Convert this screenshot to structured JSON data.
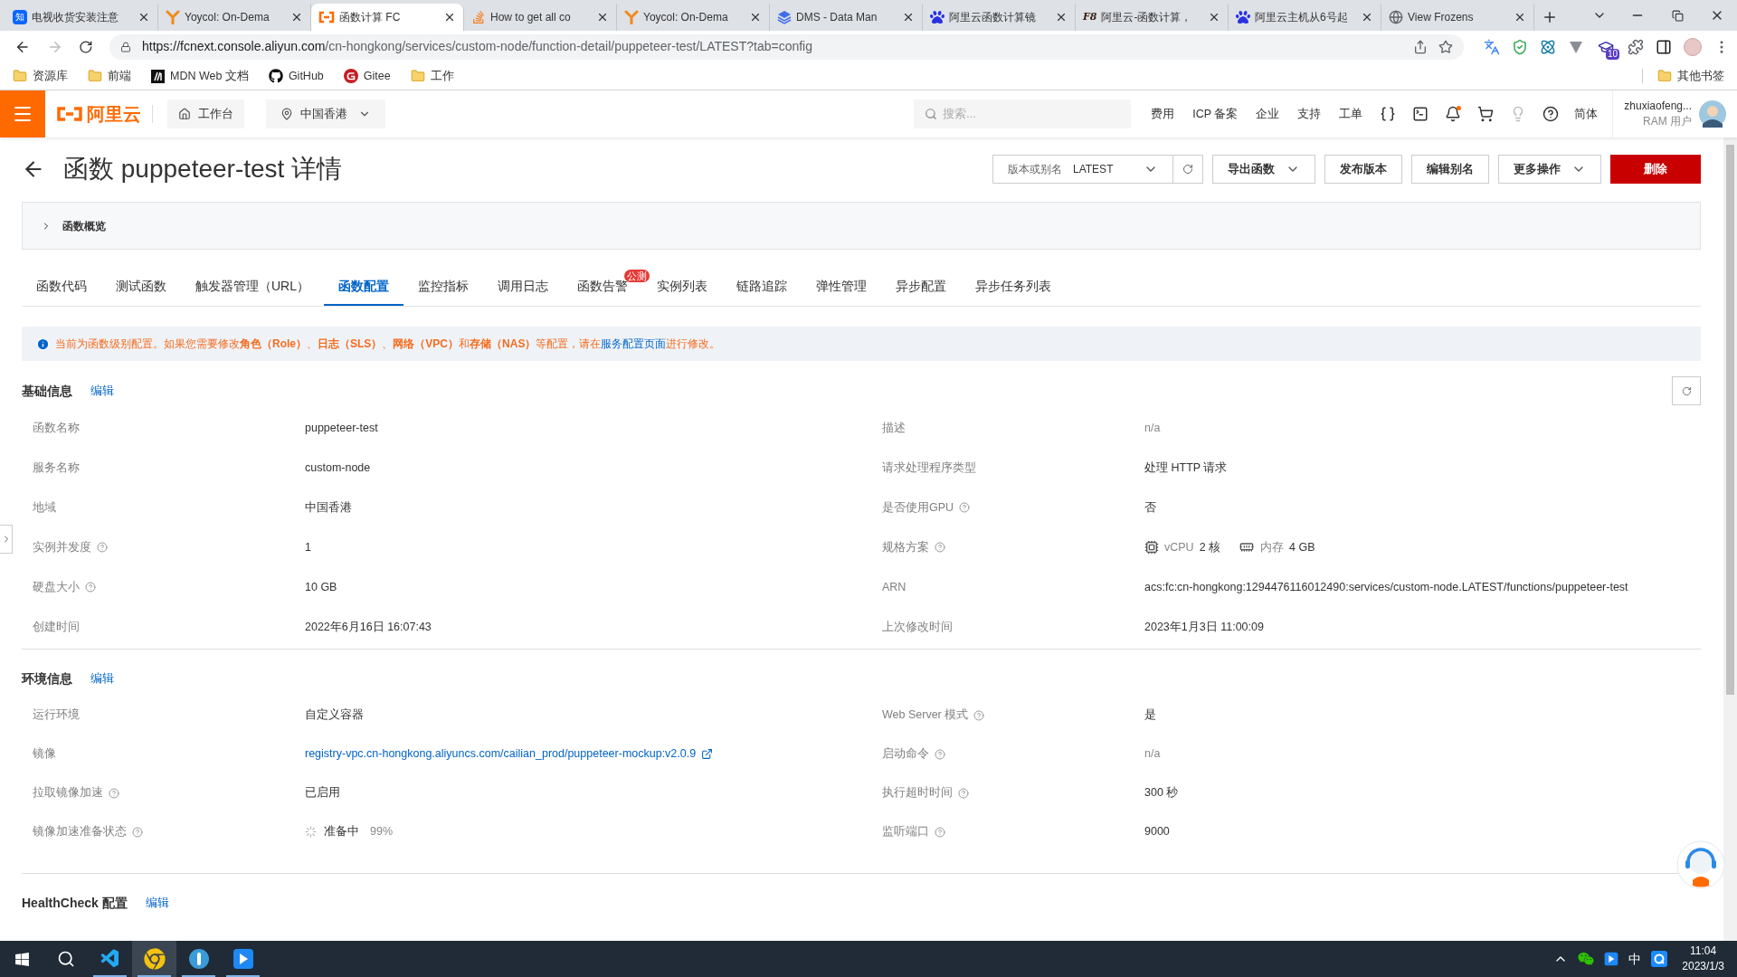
{
  "browser": {
    "tabs": [
      {
        "icon_text": "知",
        "title": "电视收货安装注意",
        "selected": false
      },
      {
        "title": "Yoycol: On-Dema",
        "selected": false
      },
      {
        "title": "函数计算 FC",
        "selected": true
      },
      {
        "title": "How to get all co",
        "selected": false
      },
      {
        "title": "Yoycol: On-Dema",
        "selected": false
      },
      {
        "title": "DMS - Data Man",
        "selected": false
      },
      {
        "title": "阿里云函数计算镜",
        "selected": false
      },
      {
        "icon_text": "F8",
        "title": "阿里云-函数计算，",
        "selected": false
      },
      {
        "title": "阿里云主机从6号起",
        "selected": false
      },
      {
        "title": "View Frozens",
        "selected": false
      }
    ],
    "url_host": "https://fcnext.console.aliyun.com",
    "url_path": "/cn-hongkong/services/custom-node/function-detail/puppeteer-test/LATEST?tab=config",
    "extension_badge": "10",
    "bookmarks": [
      "资源库",
      "前端",
      "MDN Web 文档",
      "GitHub",
      "Gitee",
      "工作"
    ],
    "other_bookmarks": "其他书签"
  },
  "console_header": {
    "logo": "阿里云",
    "workbench": "工作台",
    "region": "中国香港",
    "search": {
      "placeholder": "搜索..."
    },
    "nav": [
      "费用",
      "ICP 备案",
      "企业",
      "支持",
      "工单"
    ],
    "nav_icons": [
      {
        "dot": false
      },
      {
        "dot": false
      },
      {
        "dot": true
      },
      {
        "dot": false
      },
      {
        "dot": false
      },
      {
        "dot": false
      }
    ],
    "language": "简体",
    "user": {
      "name": "zhuxiaofeng...",
      "role": "RAM 用户"
    }
  },
  "page": {
    "title": "函数 puppeteer-test 详情",
    "version_select": {
      "label": "版本或别名",
      "value": "LATEST"
    },
    "buttons": [
      {
        "label": "导出函数",
        "kind": "dropdown"
      },
      {
        "label": "发布版本",
        "kind": "plain"
      },
      {
        "label": "编辑别名",
        "kind": "plain"
      },
      {
        "label": "更多操作",
        "kind": "dropdown"
      },
      {
        "label": "删除",
        "kind": "danger"
      }
    ],
    "overview": {
      "title": "函数概览",
      "expanded": false
    },
    "tabs": [
      {
        "label": "函数代码",
        "selected": false
      },
      {
        "label": "测试函数",
        "selected": false
      },
      {
        "label": "触发器管理（URL）",
        "selected": false
      },
      {
        "label": "函数配置",
        "selected": true
      },
      {
        "label": "监控指标",
        "selected": false
      },
      {
        "label": "调用日志",
        "selected": false
      },
      {
        "label": "函数告警",
        "selected": false,
        "badge": "公测"
      },
      {
        "label": "实例列表",
        "selected": false
      },
      {
        "label": "链路追踪",
        "selected": false
      },
      {
        "label": "弹性管理",
        "selected": false
      },
      {
        "label": "异步配置",
        "selected": false
      },
      {
        "label": "异步任务列表",
        "selected": false
      }
    ],
    "notice": {
      "before": "当前为函数级别配置。如果您需要修改**角色（Role）**、**日志（SLS）**、**网络（VPC）**和**存储（NAS）**等配置，请在",
      "link": "服务配置页面",
      "after": "进行修改。"
    },
    "sections": [
      {
        "title": "基础信息",
        "edit": "编辑",
        "refresh": true,
        "rows": [
          [
            {
              "label": "函数名称",
              "help": false,
              "kind": "text",
              "value": "puppeteer-test"
            },
            {
              "label": "描述",
              "help": false,
              "kind": "muted",
              "value": "n/a"
            }
          ],
          [
            {
              "label": "服务名称",
              "help": false,
              "kind": "text",
              "value": "custom-node"
            },
            {
              "label": "请求处理程序类型",
              "help": false,
              "kind": "text",
              "value": "处理 HTTP 请求"
            }
          ],
          [
            {
              "label": "地域",
              "help": false,
              "kind": "text",
              "value": "中国香港"
            },
            {
              "label": "是否使用GPU",
              "help": true,
              "kind": "text",
              "value": "否"
            }
          ],
          [
            {
              "label": "实例并发度",
              "help": true,
              "kind": "text",
              "value": "1"
            },
            {
              "label": "规格方案",
              "help": true,
              "kind": "spec",
              "items": [
                {
                  "label": "vCPU",
                  "value": "2 核"
                },
                {
                  "label": "内存",
                  "value": "4 GB"
                }
              ]
            }
          ],
          [
            {
              "label": "硬盘大小",
              "help": true,
              "kind": "text",
              "value": "10 GB"
            },
            {
              "label": "ARN",
              "help": false,
              "kind": "text",
              "value": "acs:fc:cn-hongkong:1294476116012490:services/custom-node.LATEST/functions/puppeteer-test"
            }
          ],
          [
            {
              "label": "创建时间",
              "help": false,
              "kind": "text",
              "value": "2022年6月16日 16:07:43"
            },
            {
              "label": "上次修改时间",
              "help": false,
              "kind": "text",
              "value": "2023年1月3日 11:00:09"
            }
          ]
        ]
      },
      {
        "title": "环境信息",
        "edit": "编辑",
        "refresh": false,
        "rows": [
          [
            {
              "label": "运行环境",
              "help": false,
              "kind": "text",
              "value": "自定义容器"
            },
            {
              "label": "Web Server 模式",
              "help": true,
              "kind": "text",
              "value": "是"
            }
          ],
          [
            {
              "label": "镜像",
              "help": false,
              "kind": "link",
              "value": "registry-vpc.cn-hongkong.aliyuncs.com/cailian_prod/puppeteer-mockup:v2.0.9"
            },
            {
              "label": "启动命令",
              "help": true,
              "kind": "muted",
              "value": "n/a"
            }
          ],
          [
            {
              "label": "拉取镜像加速",
              "help": true,
              "kind": "text",
              "value": "已启用"
            },
            {
              "label": "执行超时时间",
              "help": true,
              "kind": "text",
              "value": "300 秒"
            }
          ],
          [
            {
              "label": "镜像加速准备状态",
              "help": true,
              "kind": "status",
              "value": "准备中",
              "detail": "99%"
            },
            {
              "label": "监听端口",
              "help": true,
              "kind": "text",
              "value": "9000"
            }
          ]
        ]
      },
      {
        "title": "HealthCheck 配置",
        "edit": "编辑",
        "refresh": false
      }
    ]
  },
  "taskbar": {
    "apps": [
      {
        "running": false,
        "selected": false
      },
      {
        "running": true,
        "selected": false
      },
      {
        "running": true,
        "selected": true
      },
      {
        "running": true,
        "selected": false
      },
      {
        "running": true,
        "selected": false
      }
    ],
    "ime": "中",
    "time": "11:04",
    "date": "2023/1/3"
  }
}
